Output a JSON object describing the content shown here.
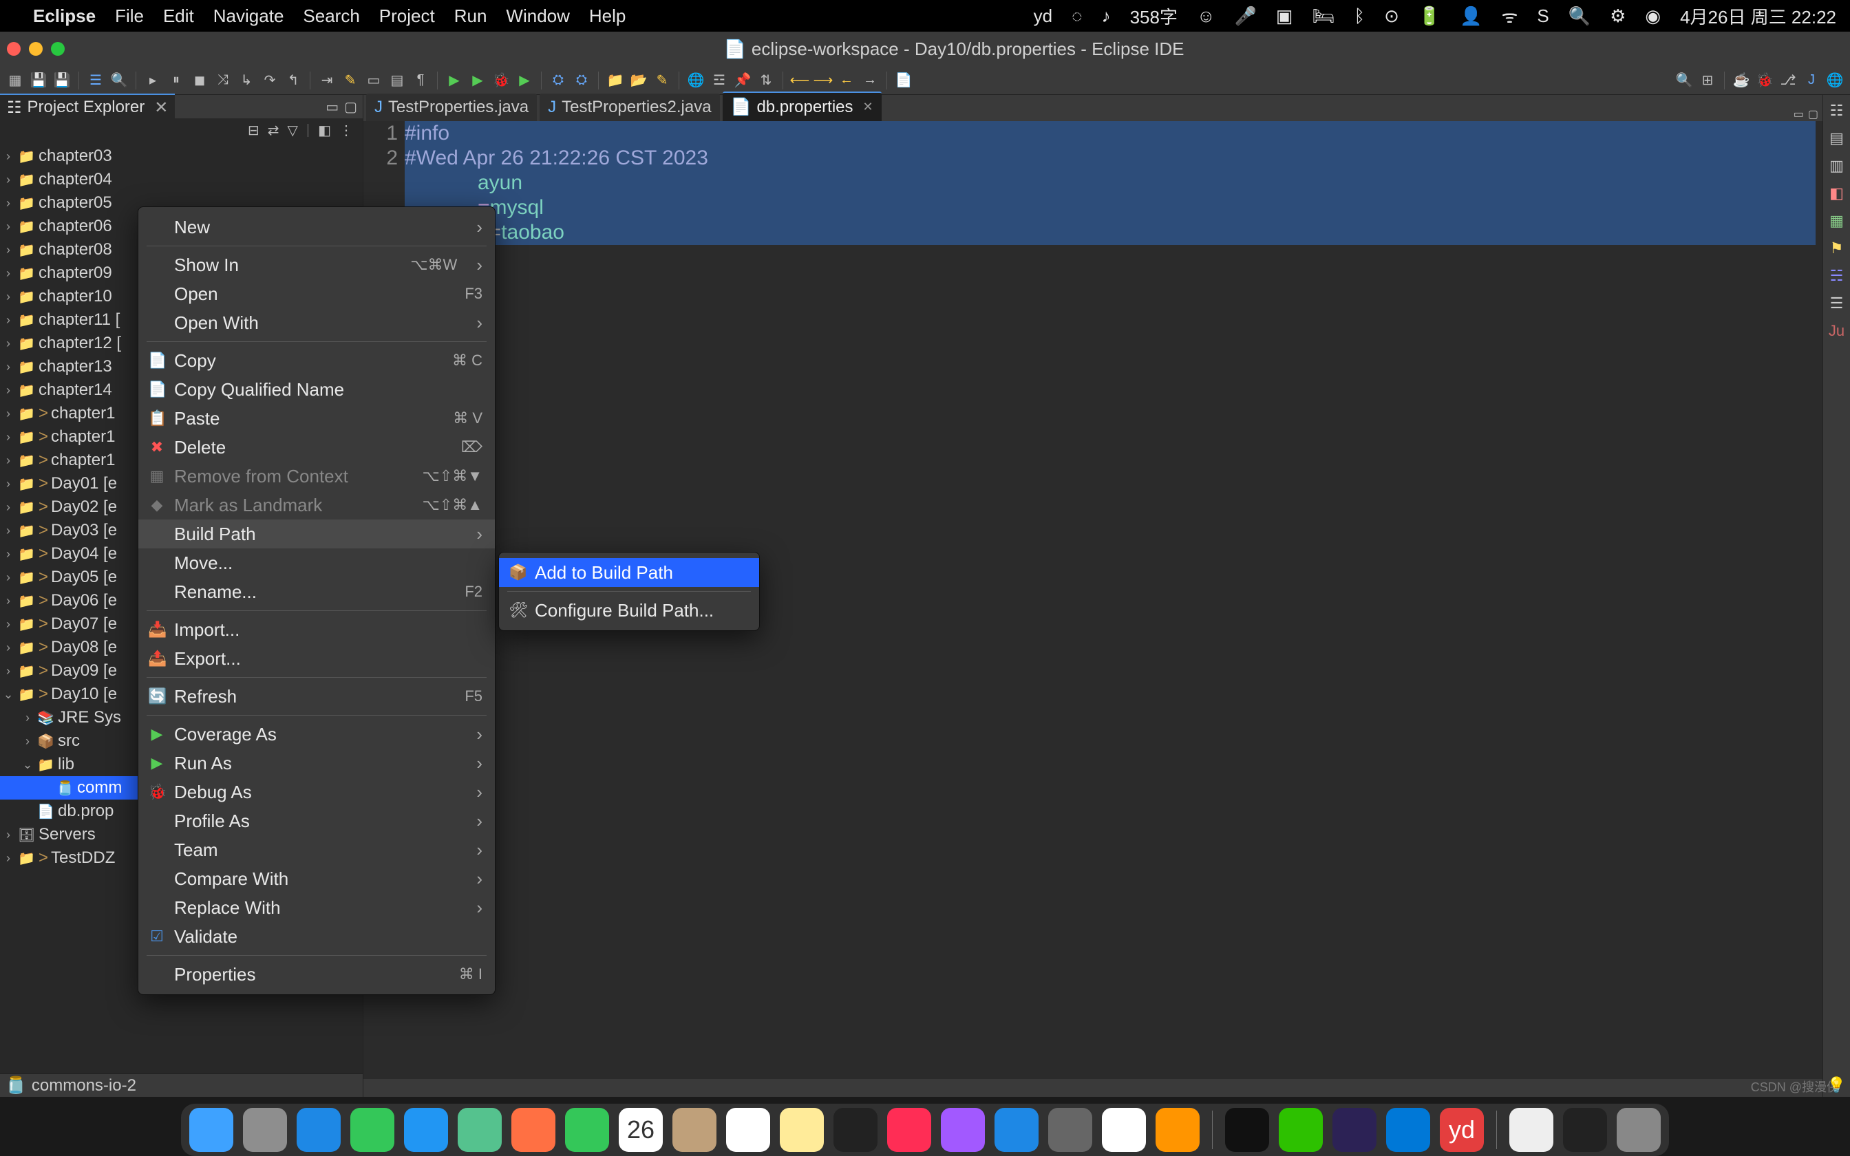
{
  "menubar": {
    "app": "Eclipse",
    "items": [
      "File",
      "Edit",
      "Navigate",
      "Search",
      "Project",
      "Run",
      "Window",
      "Help"
    ],
    "status_text": "358字",
    "datetime": "4月26日 周三  22:22"
  },
  "window": {
    "title": "eclipse-workspace - Day10/db.properties - Eclipse IDE"
  },
  "project_explorer": {
    "title": "Project Explorer",
    "items": [
      {
        "label": "chapter03",
        "indent": 0,
        "expandable": true,
        "icon": "proj"
      },
      {
        "label": "chapter04",
        "indent": 0,
        "expandable": true,
        "icon": "proj"
      },
      {
        "label": "chapter05",
        "indent": 0,
        "expandable": true,
        "icon": "proj"
      },
      {
        "label": "chapter06",
        "indent": 0,
        "expandable": true,
        "icon": "proj"
      },
      {
        "label": "chapter08",
        "indent": 0,
        "expandable": true,
        "icon": "proj"
      },
      {
        "label": "chapter09",
        "indent": 0,
        "expandable": true,
        "icon": "proj"
      },
      {
        "label": "chapter10",
        "indent": 0,
        "expandable": true,
        "icon": "proj"
      },
      {
        "label": "chapter11 [",
        "indent": 0,
        "expandable": true,
        "icon": "proj"
      },
      {
        "label": "chapter12 [",
        "indent": 0,
        "expandable": true,
        "icon": "proj"
      },
      {
        "label": "chapter13",
        "indent": 0,
        "expandable": true,
        "icon": "proj"
      },
      {
        "label": "chapter14",
        "indent": 0,
        "expandable": true,
        "icon": "proj"
      },
      {
        "label": "chapter1",
        "indent": 0,
        "expandable": true,
        "icon": "proj",
        "decorated": true
      },
      {
        "label": "chapter1",
        "indent": 0,
        "expandable": true,
        "icon": "proj",
        "decorated": true
      },
      {
        "label": "chapter1",
        "indent": 0,
        "expandable": true,
        "icon": "proj",
        "decorated": true
      },
      {
        "label": "Day01 [e",
        "indent": 0,
        "expandable": true,
        "icon": "proj",
        "decorated": true
      },
      {
        "label": "Day02 [e",
        "indent": 0,
        "expandable": true,
        "icon": "proj",
        "decorated": true
      },
      {
        "label": "Day03 [e",
        "indent": 0,
        "expandable": true,
        "icon": "proj",
        "decorated": true
      },
      {
        "label": "Day04 [e",
        "indent": 0,
        "expandable": true,
        "icon": "proj",
        "decorated": true
      },
      {
        "label": "Day05 [e",
        "indent": 0,
        "expandable": true,
        "icon": "proj",
        "decorated": true
      },
      {
        "label": "Day06 [e",
        "indent": 0,
        "expandable": true,
        "icon": "proj",
        "decorated": true
      },
      {
        "label": "Day07 [e",
        "indent": 0,
        "expandable": true,
        "icon": "proj",
        "decorated": true
      },
      {
        "label": "Day08 [e",
        "indent": 0,
        "expandable": true,
        "icon": "proj",
        "decorated": true
      },
      {
        "label": "Day09 [e",
        "indent": 0,
        "expandable": true,
        "icon": "proj",
        "decorated": true
      },
      {
        "label": "Day10 [e",
        "indent": 0,
        "expandable": true,
        "icon": "proj",
        "decorated": true,
        "expanded": true
      },
      {
        "label": "JRE Sys",
        "indent": 1,
        "expandable": true,
        "icon": "jre"
      },
      {
        "label": "src",
        "indent": 1,
        "expandable": true,
        "icon": "src"
      },
      {
        "label": "lib",
        "indent": 1,
        "expandable": true,
        "icon": "folder",
        "expanded": true
      },
      {
        "label": "comm",
        "indent": 2,
        "expandable": false,
        "icon": "jar",
        "selected": true
      },
      {
        "label": "db.prop",
        "indent": 1,
        "expandable": false,
        "icon": "file"
      },
      {
        "label": "Servers",
        "indent": 0,
        "expandable": true,
        "icon": "servers"
      },
      {
        "label": "TestDDZ",
        "indent": 0,
        "expandable": true,
        "icon": "proj",
        "decorated": true
      }
    ],
    "breadcrumb": "commons-io-2"
  },
  "editor": {
    "tabs": [
      {
        "label": "TestProperties.java",
        "icon": "J",
        "active": false
      },
      {
        "label": "TestProperties2.java",
        "icon": "J",
        "active": false
      },
      {
        "label": "db.properties",
        "icon": "file",
        "active": true,
        "closeable": true
      }
    ],
    "line_numbers": [
      "1",
      "2"
    ],
    "lines_visible": {
      "l1": "#info",
      "l2": "#Wed Apr 26 21:22:26 CST 2023",
      "l3_frag": "ayun",
      "l4_frag_key": "mysql",
      "l5_frag_eq": "e=",
      "l5_frag_val": "taobao"
    }
  },
  "context_menu": {
    "groups": [
      [
        {
          "label": "New",
          "submenu": true
        }
      ],
      [
        {
          "label": "Show In",
          "shortcut": "⌥⌘W",
          "submenu": true
        },
        {
          "label": "Open",
          "shortcut": "F3"
        },
        {
          "label": "Open With",
          "submenu": true
        }
      ],
      [
        {
          "label": "Copy",
          "icon": "📄",
          "shortcut": "⌘ C"
        },
        {
          "label": "Copy Qualified Name",
          "icon": "📄"
        },
        {
          "label": "Paste",
          "icon": "📋",
          "shortcut": "⌘ V"
        },
        {
          "label": "Delete",
          "icon": "✖",
          "shortcut": "⌦",
          "iconcolor": "#ff5555"
        },
        {
          "label": "Remove from Context",
          "icon": "▦",
          "shortcut": "⌥⇧⌘▼",
          "disabled": true
        },
        {
          "label": "Mark as Landmark",
          "icon": "◆",
          "shortcut": "⌥⇧⌘▲",
          "disabled": true
        },
        {
          "label": "Build Path",
          "submenu": true,
          "hover": true
        },
        {
          "label": "Move..."
        },
        {
          "label": "Rename...",
          "shortcut": "F2"
        }
      ],
      [
        {
          "label": "Import...",
          "icon": "📥"
        },
        {
          "label": "Export...",
          "icon": "📤"
        }
      ],
      [
        {
          "label": "Refresh",
          "icon": "🔄",
          "shortcut": "F5"
        }
      ],
      [
        {
          "label": "Coverage As",
          "icon": "▶",
          "submenu": true,
          "iconcolor": "#55cc55"
        },
        {
          "label": "Run As",
          "icon": "▶",
          "submenu": true,
          "iconcolor": "#55cc55"
        },
        {
          "label": "Debug As",
          "icon": "🐞",
          "submenu": true,
          "iconcolor": "#7fbf7f"
        },
        {
          "label": "Profile As",
          "submenu": true
        },
        {
          "label": "Team",
          "submenu": true
        },
        {
          "label": "Compare With",
          "submenu": true
        },
        {
          "label": "Replace With",
          "submenu": true
        },
        {
          "label": "Validate",
          "icon": "☑",
          "iconcolor": "#4a90e2"
        }
      ],
      [
        {
          "label": "Properties",
          "shortcut": "⌘  I"
        }
      ]
    ]
  },
  "submenu": {
    "items": [
      {
        "label": "Add to Build Path",
        "icon": "📦",
        "selected": true
      },
      {
        "label": "Configure Build Path...",
        "icon": "🛠"
      }
    ]
  },
  "dock": {
    "items": [
      {
        "name": "finder",
        "bg": "#3ea2ff"
      },
      {
        "name": "launchpad",
        "bg": "#8e8e8e"
      },
      {
        "name": "safari",
        "bg": "#1e88e5"
      },
      {
        "name": "messages",
        "bg": "#34c759"
      },
      {
        "name": "mail",
        "bg": "#2196f3"
      },
      {
        "name": "maps",
        "bg": "#55c28e"
      },
      {
        "name": "photos",
        "bg": "#ff7043"
      },
      {
        "name": "facetime",
        "bg": "#34c759"
      },
      {
        "name": "calendar",
        "bg": "#ffffff",
        "text": "26"
      },
      {
        "name": "contacts",
        "bg": "#bfa07a"
      },
      {
        "name": "reminders",
        "bg": "#ffffff"
      },
      {
        "name": "notes",
        "bg": "#ffeb99"
      },
      {
        "name": "tv",
        "bg": "#222"
      },
      {
        "name": "music",
        "bg": "#ff2d55"
      },
      {
        "name": "podcasts",
        "bg": "#a259ff"
      },
      {
        "name": "appstore",
        "bg": "#1e88e5"
      },
      {
        "name": "settings",
        "bg": "#666"
      },
      {
        "name": "chrome",
        "bg": "#fff"
      },
      {
        "name": "firefox",
        "bg": "#ff9500"
      },
      {
        "name": "sep"
      },
      {
        "name": "douyin",
        "bg": "#111"
      },
      {
        "name": "wechat",
        "bg": "#2dc100"
      },
      {
        "name": "eclipse",
        "bg": "#2c2255"
      },
      {
        "name": "vscode",
        "bg": "#0078d7"
      },
      {
        "name": "youdao",
        "bg": "#e43e3e",
        "text": "yd"
      },
      {
        "name": "sep"
      },
      {
        "name": "textedit",
        "bg": "#eee"
      },
      {
        "name": "terminal",
        "bg": "#222"
      },
      {
        "name": "trash",
        "bg": "#888"
      }
    ]
  },
  "watermark": "CSDN @搜漫侠"
}
